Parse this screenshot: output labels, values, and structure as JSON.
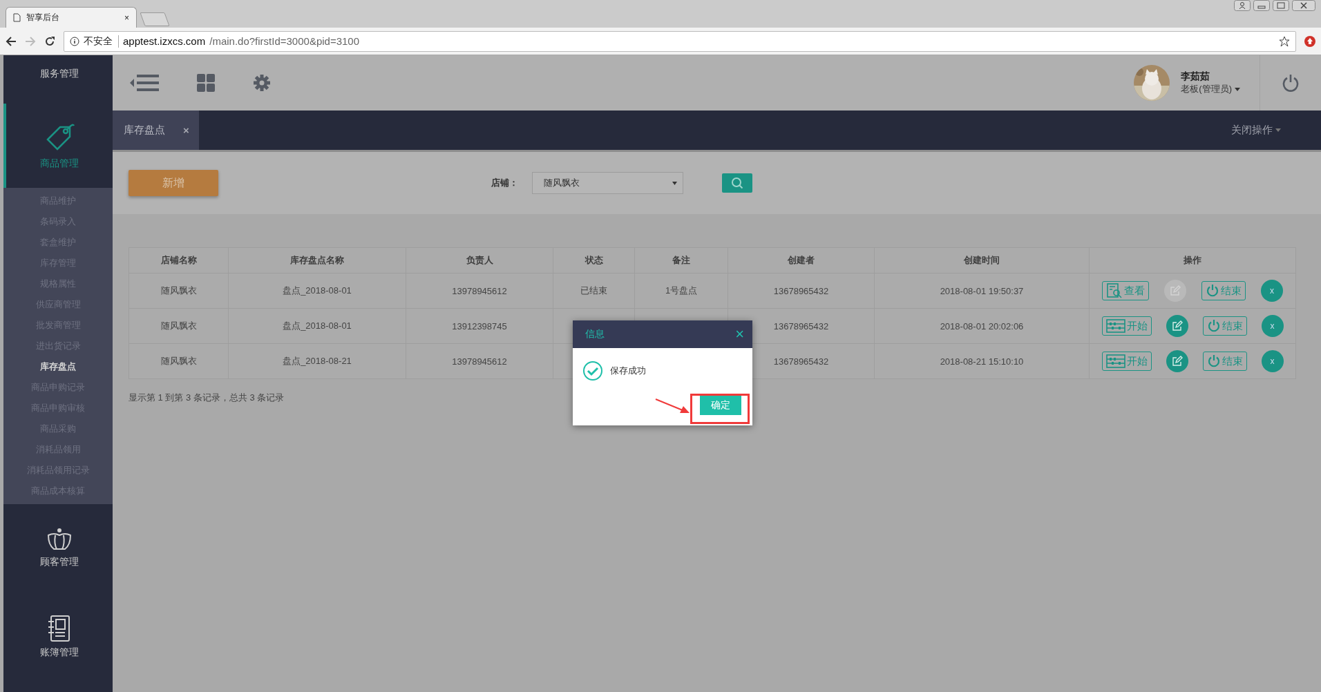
{
  "browser": {
    "tab_title": "智享后台",
    "tab_close": "×",
    "security": "不安全",
    "url_host": "apptest.izxcs.com",
    "url_path": "/main.do?firstId=3000&pid=3100"
  },
  "sidebar": {
    "items": [
      {
        "label": "服务管理",
        "kind": "service",
        "selected": false
      },
      {
        "label": "商品管理",
        "kind": "tag",
        "selected": true,
        "children": [
          {
            "label": "商品维护",
            "selected": false
          },
          {
            "label": "条码录入",
            "selected": false
          },
          {
            "label": "套盒维护",
            "selected": false
          },
          {
            "label": "库存管理",
            "selected": false
          },
          {
            "label": "规格属性",
            "selected": false
          },
          {
            "label": "供应商管理",
            "selected": false
          },
          {
            "label": "批发商管理",
            "selected": false
          },
          {
            "label": "进出货记录",
            "selected": false
          },
          {
            "label": "库存盘点",
            "selected": true
          },
          {
            "label": "商品申购记录",
            "selected": false
          },
          {
            "label": "商品申购审核",
            "selected": false
          },
          {
            "label": "商品采购",
            "selected": false
          },
          {
            "label": "消耗品领用",
            "selected": false
          },
          {
            "label": "消耗品领用记录",
            "selected": false
          },
          {
            "label": "商品成本核算",
            "selected": false
          }
        ]
      },
      {
        "label": "顾客管理",
        "kind": "crown",
        "selected": false
      },
      {
        "label": "账簿管理",
        "kind": "ledger",
        "selected": false
      }
    ]
  },
  "header": {
    "user_name": "李茹茹",
    "user_role": "老板(管理员)"
  },
  "tabs": [
    {
      "label": "库存盘点",
      "close": "×",
      "selected": true
    }
  ],
  "close_ops": "关闭操作",
  "toolbar": {
    "add_button": "新增",
    "store_label": "店铺：",
    "store_value": "随风飘衣"
  },
  "table": {
    "columns": [
      "店铺名称",
      "库存盘点名称",
      "负责人",
      "状态",
      "备注",
      "创建者",
      "创建时间",
      "操作"
    ],
    "rows": [
      {
        "store": "随风飘衣",
        "name": "盘点_2018-08-01",
        "owner": "13978945612",
        "status": "已结束",
        "remark": "1号盘点",
        "creator": "13678965432",
        "time": "2018-08-01 19:50:37",
        "actions": [
          {
            "kind": "view",
            "label": "查看"
          },
          {
            "kind": "edit",
            "disabled": true
          },
          {
            "kind": "end",
            "label": "结束"
          },
          {
            "kind": "delete",
            "label": "x"
          }
        ]
      },
      {
        "store": "随风飘衣",
        "name": "盘点_2018-08-01",
        "owner": "13912398745",
        "creator": "13678965432",
        "time": "2018-08-01 20:02:06",
        "actions": [
          {
            "kind": "start",
            "label": "开始"
          },
          {
            "kind": "edit",
            "disabled": false
          },
          {
            "kind": "end",
            "label": "结束"
          },
          {
            "kind": "delete",
            "label": "x"
          }
        ]
      },
      {
        "store": "随风飘衣",
        "name": "盘点_2018-08-21",
        "owner": "13978945612",
        "creator": "13678965432",
        "time": "2018-08-21 15:10:10",
        "actions": [
          {
            "kind": "start",
            "label": "开始"
          },
          {
            "kind": "edit",
            "disabled": false
          },
          {
            "kind": "end",
            "label": "结束"
          },
          {
            "kind": "delete",
            "label": "x"
          }
        ]
      }
    ]
  },
  "footer": "显示第 1 到第 3 条记录，总共 3 条记录",
  "dialog": {
    "title": "信息",
    "close": "×",
    "message": "保存成功",
    "confirm": "确定"
  }
}
